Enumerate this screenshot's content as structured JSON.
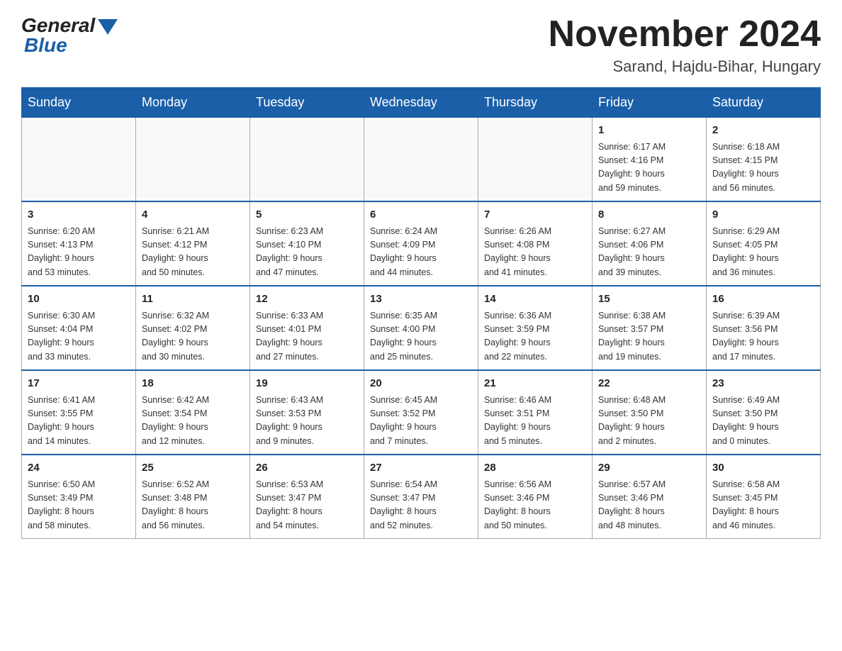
{
  "header": {
    "month_title": "November 2024",
    "location": "Sarand, Hajdu-Bihar, Hungary",
    "logo_general": "General",
    "logo_blue": "Blue"
  },
  "weekdays": [
    "Sunday",
    "Monday",
    "Tuesday",
    "Wednesday",
    "Thursday",
    "Friday",
    "Saturday"
  ],
  "weeks": [
    [
      {
        "day": "",
        "info": ""
      },
      {
        "day": "",
        "info": ""
      },
      {
        "day": "",
        "info": ""
      },
      {
        "day": "",
        "info": ""
      },
      {
        "day": "",
        "info": ""
      },
      {
        "day": "1",
        "info": "Sunrise: 6:17 AM\nSunset: 4:16 PM\nDaylight: 9 hours\nand 59 minutes."
      },
      {
        "day": "2",
        "info": "Sunrise: 6:18 AM\nSunset: 4:15 PM\nDaylight: 9 hours\nand 56 minutes."
      }
    ],
    [
      {
        "day": "3",
        "info": "Sunrise: 6:20 AM\nSunset: 4:13 PM\nDaylight: 9 hours\nand 53 minutes."
      },
      {
        "day": "4",
        "info": "Sunrise: 6:21 AM\nSunset: 4:12 PM\nDaylight: 9 hours\nand 50 minutes."
      },
      {
        "day": "5",
        "info": "Sunrise: 6:23 AM\nSunset: 4:10 PM\nDaylight: 9 hours\nand 47 minutes."
      },
      {
        "day": "6",
        "info": "Sunrise: 6:24 AM\nSunset: 4:09 PM\nDaylight: 9 hours\nand 44 minutes."
      },
      {
        "day": "7",
        "info": "Sunrise: 6:26 AM\nSunset: 4:08 PM\nDaylight: 9 hours\nand 41 minutes."
      },
      {
        "day": "8",
        "info": "Sunrise: 6:27 AM\nSunset: 4:06 PM\nDaylight: 9 hours\nand 39 minutes."
      },
      {
        "day": "9",
        "info": "Sunrise: 6:29 AM\nSunset: 4:05 PM\nDaylight: 9 hours\nand 36 minutes."
      }
    ],
    [
      {
        "day": "10",
        "info": "Sunrise: 6:30 AM\nSunset: 4:04 PM\nDaylight: 9 hours\nand 33 minutes."
      },
      {
        "day": "11",
        "info": "Sunrise: 6:32 AM\nSunset: 4:02 PM\nDaylight: 9 hours\nand 30 minutes."
      },
      {
        "day": "12",
        "info": "Sunrise: 6:33 AM\nSunset: 4:01 PM\nDaylight: 9 hours\nand 27 minutes."
      },
      {
        "day": "13",
        "info": "Sunrise: 6:35 AM\nSunset: 4:00 PM\nDaylight: 9 hours\nand 25 minutes."
      },
      {
        "day": "14",
        "info": "Sunrise: 6:36 AM\nSunset: 3:59 PM\nDaylight: 9 hours\nand 22 minutes."
      },
      {
        "day": "15",
        "info": "Sunrise: 6:38 AM\nSunset: 3:57 PM\nDaylight: 9 hours\nand 19 minutes."
      },
      {
        "day": "16",
        "info": "Sunrise: 6:39 AM\nSunset: 3:56 PM\nDaylight: 9 hours\nand 17 minutes."
      }
    ],
    [
      {
        "day": "17",
        "info": "Sunrise: 6:41 AM\nSunset: 3:55 PM\nDaylight: 9 hours\nand 14 minutes."
      },
      {
        "day": "18",
        "info": "Sunrise: 6:42 AM\nSunset: 3:54 PM\nDaylight: 9 hours\nand 12 minutes."
      },
      {
        "day": "19",
        "info": "Sunrise: 6:43 AM\nSunset: 3:53 PM\nDaylight: 9 hours\nand 9 minutes."
      },
      {
        "day": "20",
        "info": "Sunrise: 6:45 AM\nSunset: 3:52 PM\nDaylight: 9 hours\nand 7 minutes."
      },
      {
        "day": "21",
        "info": "Sunrise: 6:46 AM\nSunset: 3:51 PM\nDaylight: 9 hours\nand 5 minutes."
      },
      {
        "day": "22",
        "info": "Sunrise: 6:48 AM\nSunset: 3:50 PM\nDaylight: 9 hours\nand 2 minutes."
      },
      {
        "day": "23",
        "info": "Sunrise: 6:49 AM\nSunset: 3:50 PM\nDaylight: 9 hours\nand 0 minutes."
      }
    ],
    [
      {
        "day": "24",
        "info": "Sunrise: 6:50 AM\nSunset: 3:49 PM\nDaylight: 8 hours\nand 58 minutes."
      },
      {
        "day": "25",
        "info": "Sunrise: 6:52 AM\nSunset: 3:48 PM\nDaylight: 8 hours\nand 56 minutes."
      },
      {
        "day": "26",
        "info": "Sunrise: 6:53 AM\nSunset: 3:47 PM\nDaylight: 8 hours\nand 54 minutes."
      },
      {
        "day": "27",
        "info": "Sunrise: 6:54 AM\nSunset: 3:47 PM\nDaylight: 8 hours\nand 52 minutes."
      },
      {
        "day": "28",
        "info": "Sunrise: 6:56 AM\nSunset: 3:46 PM\nDaylight: 8 hours\nand 50 minutes."
      },
      {
        "day": "29",
        "info": "Sunrise: 6:57 AM\nSunset: 3:46 PM\nDaylight: 8 hours\nand 48 minutes."
      },
      {
        "day": "30",
        "info": "Sunrise: 6:58 AM\nSunset: 3:45 PM\nDaylight: 8 hours\nand 46 minutes."
      }
    ]
  ]
}
